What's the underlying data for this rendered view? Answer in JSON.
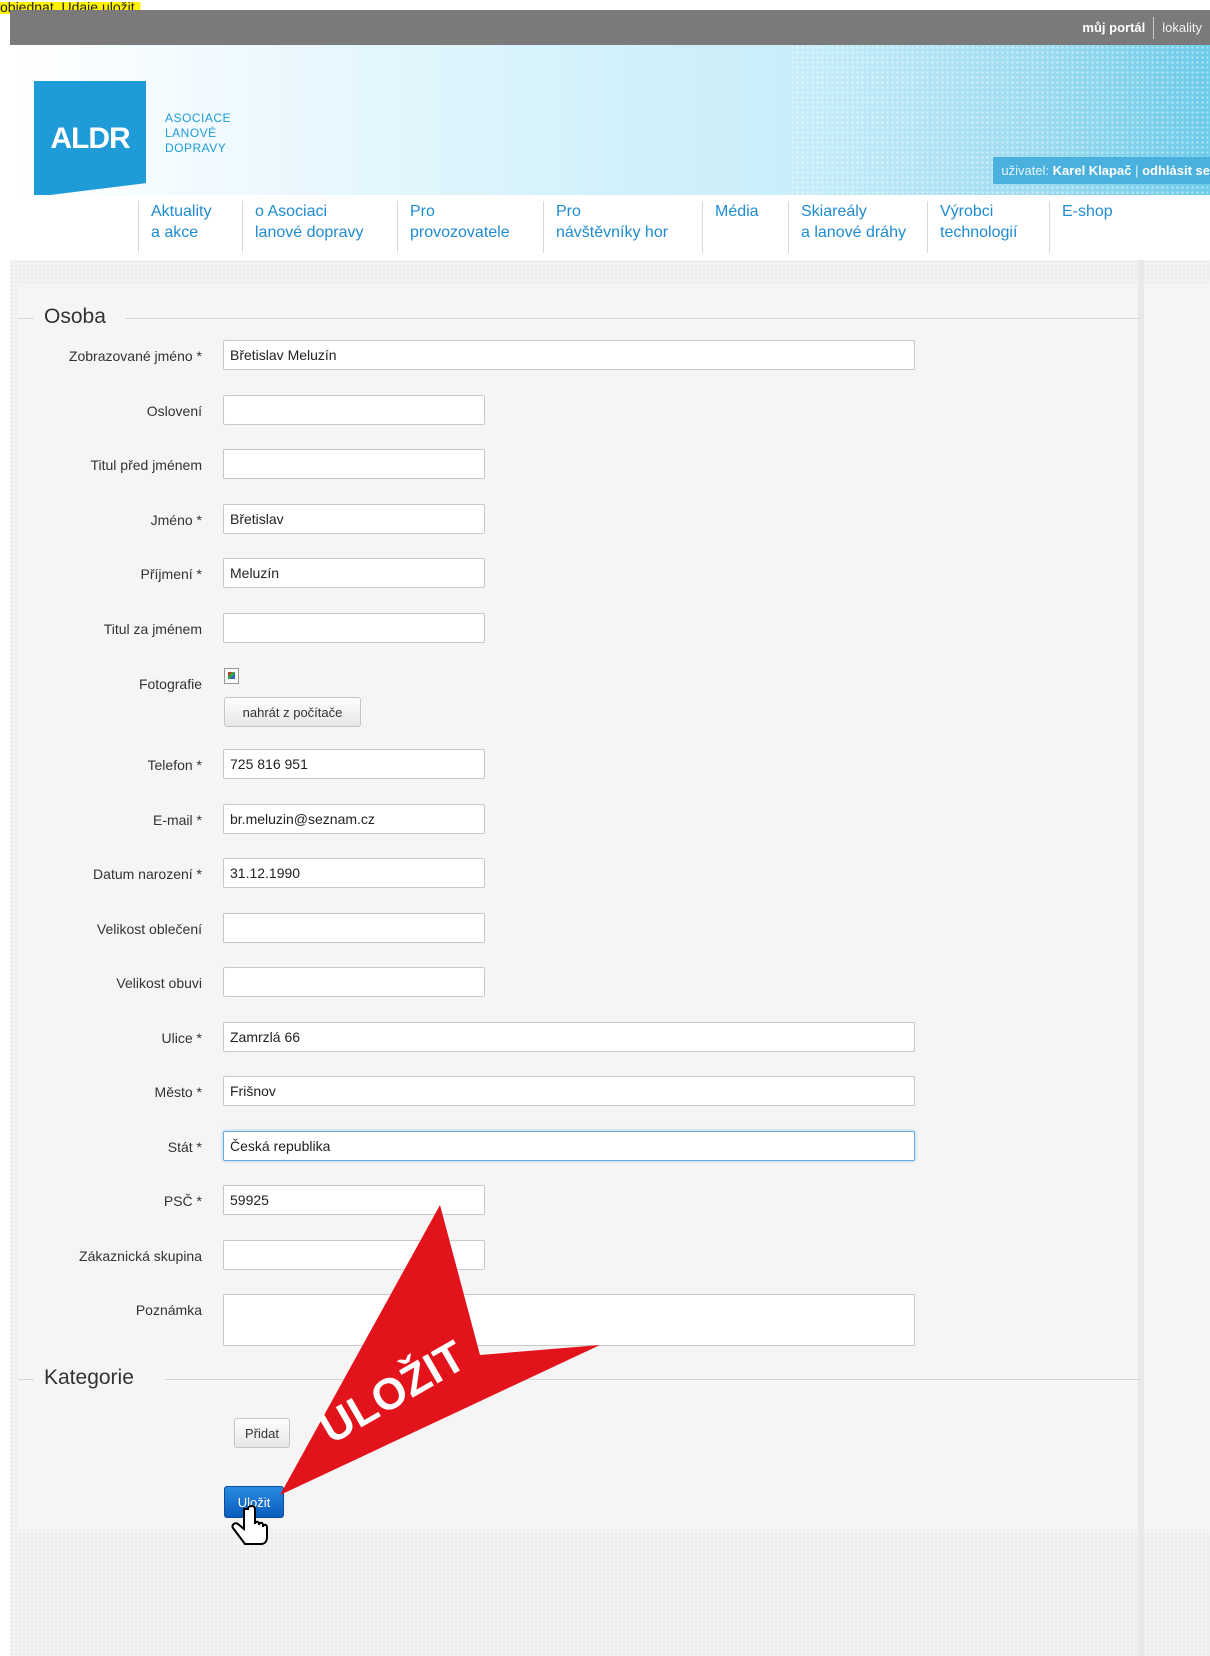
{
  "caption": "objednat. Údaje uložit.",
  "topbar": {
    "portal": "můj portál",
    "locality": "lokality"
  },
  "header": {
    "logo_mark": "ALDR",
    "logo_lines": [
      "ASOCIACE",
      "LANOVÉ",
      "DOPRAVY"
    ],
    "user_prefix": "uživatel:",
    "user_name": "Karel Klapač",
    "user_sep": "|",
    "logout": "odhlásit se"
  },
  "nav": [
    {
      "line1": "Aktuality",
      "line2": "a akce"
    },
    {
      "line1": "o Asociaci",
      "line2": "lanové dopravy"
    },
    {
      "line1": "Pro",
      "line2": "provozovatele"
    },
    {
      "line1": "Pro",
      "line2": "návštěvníky hor"
    },
    {
      "line1": "Média",
      "line2": ""
    },
    {
      "line1": "Skiareály",
      "line2": "a lanové dráhy"
    },
    {
      "line1": "Výrobci",
      "line2": "technologií"
    },
    {
      "line1": "E-shop",
      "line2": ""
    }
  ],
  "form": {
    "section_person": "Osoba",
    "fields": {
      "display_name": {
        "label": "Zobrazované jméno *",
        "value": "Břetislav Meluzín"
      },
      "salutation": {
        "label": "Oslovení",
        "value": ""
      },
      "title_before": {
        "label": "Titul před jménem",
        "value": ""
      },
      "first_name": {
        "label": "Jméno *",
        "value": "Břetislav"
      },
      "last_name": {
        "label": "Příjmení *",
        "value": "Meluzín"
      },
      "title_after": {
        "label": "Titul za jménem",
        "value": ""
      },
      "photo": {
        "label": "Fotografie",
        "button": "nahrát z počítače"
      },
      "phone": {
        "label": "Telefon *",
        "value": "725 816 951"
      },
      "email": {
        "label": "E-mail *",
        "value": "br.meluzin@seznam.cz"
      },
      "birth_date": {
        "label": "Datum narození *",
        "value": "31.12.1990"
      },
      "clothing_size": {
        "label": "Velikost oblečení",
        "value": ""
      },
      "shoe_size": {
        "label": "Velikost obuvi",
        "value": ""
      },
      "street": {
        "label": "Ulice *",
        "value": "Zamrzlá 66"
      },
      "city": {
        "label": "Město *",
        "value": "Frišnov"
      },
      "state": {
        "label": "Stát *",
        "value": "Česká republika"
      },
      "zip": {
        "label": "PSČ *",
        "value": "59925"
      },
      "customer_group": {
        "label": "Zákaznická skupina",
        "value": ""
      },
      "note": {
        "label": "Poznámka",
        "value": ""
      }
    },
    "section_category": "Kategorie",
    "add_button": "Přidat",
    "save_button": "Uložit"
  },
  "annotation": {
    "text": "ULOŽIT",
    "color": "#e3131b"
  },
  "colors": {
    "accent": "#1f9bd7",
    "topbar": "#7a7a7a",
    "nav_link": "#1f8bd0",
    "save": "#0a5cbb"
  }
}
